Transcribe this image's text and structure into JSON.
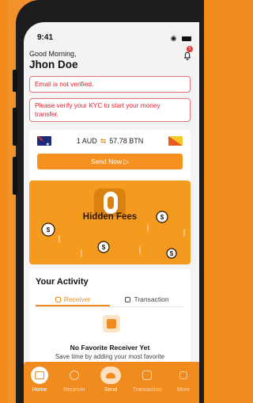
{
  "status": {
    "time": "9:41"
  },
  "header": {
    "greeting": "Good Morning,",
    "user_name": "Jhon Doe",
    "notification_count": "5"
  },
  "alerts": [
    {
      "text": "Email is not verified."
    },
    {
      "text": "Please verify your KYC to start your money transfer."
    }
  ],
  "exchange": {
    "from": "1 AUD",
    "to": "57.78 BTN",
    "swap_glyph": "⇆",
    "send_label": "Send Now ▷"
  },
  "promo": {
    "value": "0",
    "label": "Hidden Fees"
  },
  "activity": {
    "title": "Your Activity",
    "tabs": [
      {
        "label": "Receiver",
        "active": true
      },
      {
        "label": "Transaction",
        "active": false
      }
    ],
    "empty_title": "No Favorite Receiver Yet",
    "empty_subtitle": "Save time by adding your most favorite recipients."
  },
  "nav": {
    "items": [
      {
        "label": "Home",
        "icon": "home-icon",
        "active": true
      },
      {
        "label": "Receiver",
        "icon": "user-icon",
        "active": false
      },
      {
        "label": "Send",
        "icon": "send-icon",
        "active": false
      },
      {
        "label": "Transaction",
        "icon": "transaction-icon",
        "active": false
      },
      {
        "label": "More",
        "icon": "more-icon",
        "active": false
      }
    ]
  },
  "colors": {
    "brand": "#f28b1e",
    "alert_text": "#e11e2c",
    "alert_border": "#e2737a"
  }
}
